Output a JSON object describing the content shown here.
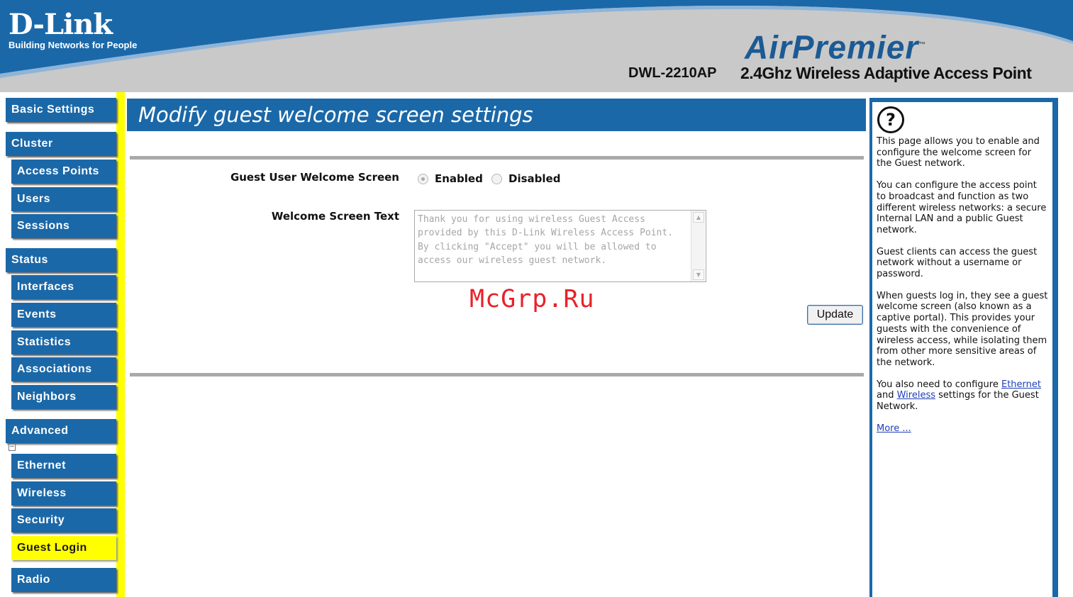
{
  "header": {
    "logo_name": "D-Link",
    "logo_tagline": "Building Networks for People",
    "product_brand": "AirPremier",
    "product_tm": "™",
    "product_model": "DWL-2210AP",
    "product_description": "2.4Ghz Wireless Adaptive Access Point"
  },
  "sidebar": {
    "items": [
      {
        "label": "Basic Settings"
      },
      {
        "label": "Cluster"
      },
      {
        "label": "Access Points"
      },
      {
        "label": "Users"
      },
      {
        "label": "Sessions"
      },
      {
        "label": "Status"
      },
      {
        "label": "Interfaces"
      },
      {
        "label": "Events"
      },
      {
        "label": "Statistics"
      },
      {
        "label": "Associations"
      },
      {
        "label": "Neighbors"
      },
      {
        "label": "Advanced"
      },
      {
        "label": "Ethernet"
      },
      {
        "label": "Wireless"
      },
      {
        "label": "Security"
      },
      {
        "label": "Guest Login",
        "active": true
      },
      {
        "label": "Radio"
      }
    ],
    "collapse_symbol": "−"
  },
  "main": {
    "title": "Modify guest welcome screen settings",
    "guest_screen_label": "Guest User Welcome Screen",
    "option_enabled": "Enabled",
    "option_disabled": "Disabled",
    "selected_option": "Enabled",
    "welcome_text_label": "Welcome Screen Text",
    "welcome_text_value": "Thank you for using wireless Guest Access provided by this D-Link Wireless Access Point. By clicking \"Accept\" you will be allowed to access our wireless guest network.",
    "update_label": "Update",
    "watermark": "McGrp.Ru"
  },
  "help": {
    "icon_symbol": "?",
    "p1": "This page allows you to enable and configure the welcome screen for the Guest network.",
    "p2": "You can configure the access point to broadcast and function as two different wireless networks: a secure Internal LAN and a public Guest network.",
    "p3": "Guest clients can access the guest network without a username or password.",
    "p4": "When guests log in, they see a guest welcome screen (also known as a captive portal). This provides your guests with the convenience of wireless access, while isolating them from other more sensitive areas of the network.",
    "p5_prefix": "You also need to configure",
    "p5_link1": "Ethernet",
    "p5_mid": "and",
    "p5_link2": "Wireless",
    "p5_suffix": "settings for the Guest Network.",
    "more_link": "More ..."
  },
  "colors": {
    "nav_blue": "#1b68a8",
    "active_yellow": "#ffff00",
    "header_gray": "#c9c9c9",
    "watermark_red": "#e8222a"
  }
}
